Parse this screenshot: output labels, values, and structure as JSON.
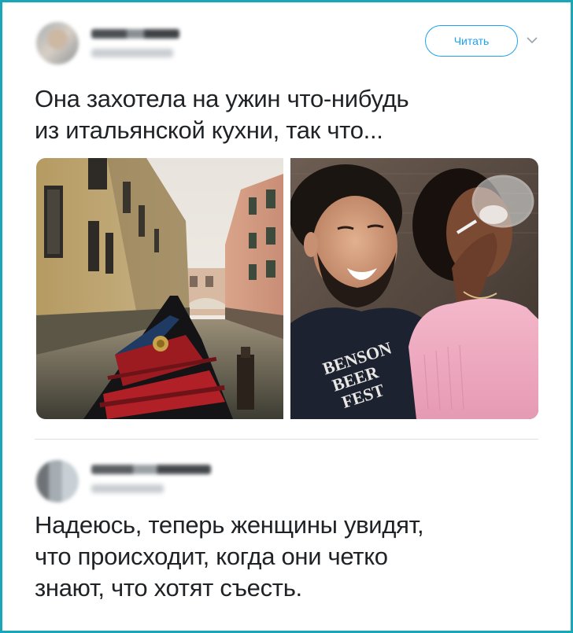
{
  "tweet1": {
    "follow_label": "Читать",
    "text_lines": [
      "Она захотела на ужин что-нибудь",
      "из итальянской кухни, так что..."
    ],
    "photo_left_icon": "venice-canal-photo",
    "photo_right_icon": "couple-drinking-photo",
    "shirt_print_lines": [
      "BENSON",
      "BEER",
      "FEST"
    ]
  },
  "tweet2": {
    "text_lines": [
      "Надеюсь, теперь женщины увидят,",
      "что происходит, когда они четко",
      "знают, что хотят съесть."
    ]
  },
  "colors": {
    "frame_border": "#19a6b8",
    "follow_accent": "#1da1f2",
    "text": "#1f2326",
    "divider": "#dcdfe2"
  }
}
